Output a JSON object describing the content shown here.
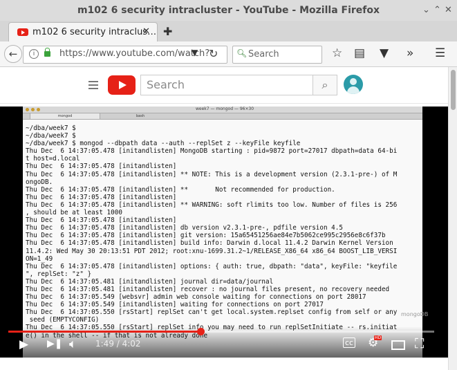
{
  "window": {
    "title": "m102 6 security intracluster - YouTube - Mozilla Firefox"
  },
  "tab": {
    "label": "m102 6 security intraclus…"
  },
  "nav": {
    "url": "https://www.youtube.com/watch?",
    "search_placeholder": "Search"
  },
  "youtube": {
    "search_placeholder": "Search"
  },
  "terminal": {
    "title": "week7 — mongod — 96×30",
    "tabs": [
      "mongod",
      "bash"
    ],
    "lines": [
      "~/dba/week7 $",
      "~/dba/week7 $",
      "~/dba/week7 $ mongod --dbpath data --auth --replSet z --keyFile keyfile",
      "Thu Dec  6 14:37:05.478 [initandlisten] MongoDB starting : pid=9872 port=27017 dbpath=data 64-bi",
      "t host=d.local",
      "Thu Dec  6 14:37:05.478 [initandlisten]",
      "Thu Dec  6 14:37:05.478 [initandlisten] ** NOTE: This is a development version (2.3.1-pre-) of M",
      "ongoDB.",
      "Thu Dec  6 14:37:05.478 [initandlisten] **       Not recommended for production.",
      "Thu Dec  6 14:37:05.478 [initandlisten]",
      "Thu Dec  6 14:37:05.478 [initandlisten] ** WARNING: soft rlimits too low. Number of files is 256",
      ", should be at least 1000",
      "Thu Dec  6 14:37:05.478 [initandlisten]",
      "Thu Dec  6 14:37:05.478 [initandlisten] db version v2.3.1-pre-, pdfile version 4.5",
      "Thu Dec  6 14:37:05.478 [initandlisten] git version: 15a65451256ae84e7b5062ce995c2956e8c6f37b",
      "Thu Dec  6 14:37:05.478 [initandlisten] build info: Darwin d.local 11.4.2 Darwin Kernel Version",
      "11.4.2: Wed May 30 20:13:51 PDT 2012; root:xnu-1699.31.2~1/RELEASE_X86_64 x86_64 BOOST_LIB_VERSI",
      "ON=1_49",
      "Thu Dec  6 14:37:05.478 [initandlisten] options: { auth: true, dbpath: \"data\", keyFile: \"keyfile",
      "\", replSet: \"z\" }",
      "Thu Dec  6 14:37:05.481 [initandlisten] journal dir=data/journal",
      "Thu Dec  6 14:37:05.481 [initandlisten] recover : no journal files present, no recovery needed",
      "Thu Dec  6 14:37:05.549 [websvr] admin web console waiting for connections on port 28017",
      "Thu Dec  6 14:37:05.549 [initandlisten] waiting for connections on port 27017",
      "Thu Dec  6 14:37:05.550 [rsStart] replSet can't get local.system.replset config from self or any",
      " seed (EMPTYCONFIG)",
      "Thu Dec  6 14:37:05.550 [rsStart] replSet info you may need to run replSetInitiate -- rs.initiat",
      "e() in the shell -- if that is not already done"
    ],
    "watermark": "mongoDB"
  },
  "player": {
    "time": "1:49 / 4:02",
    "progress": 0.451
  }
}
